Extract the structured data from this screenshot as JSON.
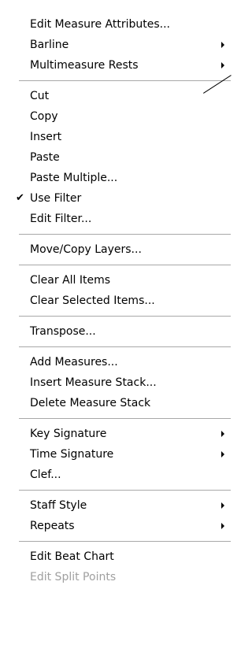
{
  "menu": {
    "items": [
      {
        "type": "item",
        "label": "Edit Measure Attributes...",
        "submenu": false
      },
      {
        "type": "item",
        "label": "Barline",
        "submenu": true
      },
      {
        "type": "item",
        "label": "Multimeasure Rests",
        "submenu": true
      },
      {
        "type": "separator"
      },
      {
        "type": "item",
        "label": "Cut",
        "submenu": false
      },
      {
        "type": "item",
        "label": "Copy",
        "submenu": false
      },
      {
        "type": "item",
        "label": "Insert",
        "submenu": false
      },
      {
        "type": "item",
        "label": "Paste",
        "submenu": false
      },
      {
        "type": "item",
        "label": "Paste Multiple...",
        "submenu": false
      },
      {
        "type": "item",
        "label": "Use Filter",
        "submenu": false,
        "checked": true,
        "check_glyph": "✔"
      },
      {
        "type": "item",
        "label": "Edit Filter...",
        "submenu": false
      },
      {
        "type": "separator"
      },
      {
        "type": "item",
        "label": "Move/Copy Layers...",
        "submenu": false
      },
      {
        "type": "separator"
      },
      {
        "type": "item",
        "label": "Clear All Items",
        "submenu": false
      },
      {
        "type": "item",
        "label": "Clear Selected Items...",
        "submenu": false
      },
      {
        "type": "separator"
      },
      {
        "type": "item",
        "label": "Transpose...",
        "submenu": false
      },
      {
        "type": "separator"
      },
      {
        "type": "item",
        "label": "Add Measures...",
        "submenu": false
      },
      {
        "type": "item",
        "label": "Insert Measure Stack...",
        "submenu": false
      },
      {
        "type": "item",
        "label": "Delete Measure Stack",
        "submenu": false
      },
      {
        "type": "separator"
      },
      {
        "type": "item",
        "label": "Key Signature",
        "submenu": true
      },
      {
        "type": "item",
        "label": "Time Signature",
        "submenu": true
      },
      {
        "type": "item",
        "label": "Clef...",
        "submenu": false
      },
      {
        "type": "separator"
      },
      {
        "type": "item",
        "label": "Staff Style",
        "submenu": true
      },
      {
        "type": "item",
        "label": "Repeats",
        "submenu": true
      },
      {
        "type": "separator"
      },
      {
        "type": "item",
        "label": "Edit Beat Chart",
        "submenu": false
      },
      {
        "type": "item",
        "label": "Edit Split Points",
        "submenu": false,
        "disabled": true
      }
    ]
  },
  "colors": {
    "text": "#000000",
    "disabled_text": "#a0a0a0",
    "separator": "#a8a8a8",
    "background": "#ffffff"
  }
}
